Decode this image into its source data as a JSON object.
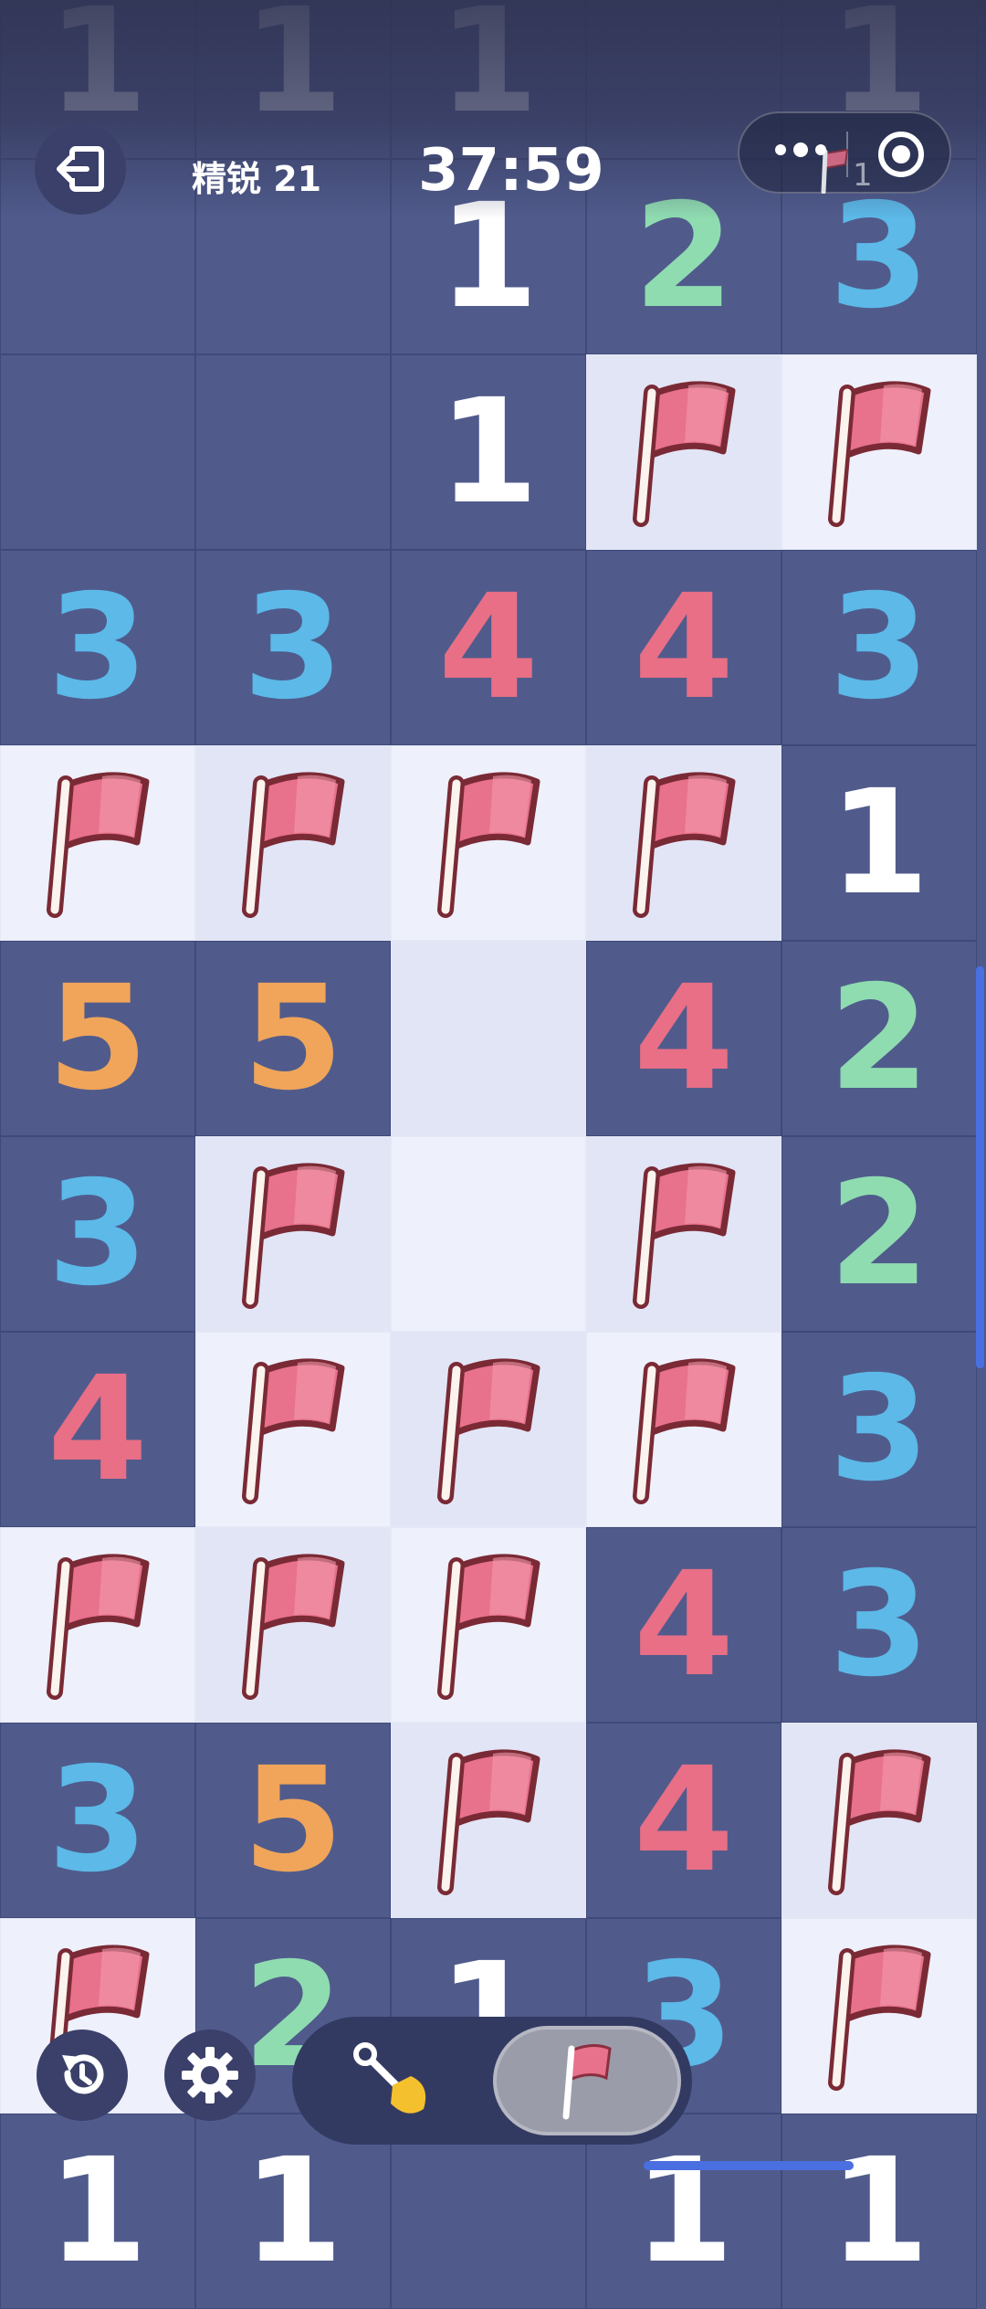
{
  "header": {
    "level_label": "精锐 21",
    "timer": "37:59",
    "flag_count": "1"
  },
  "icons": {
    "exit": "exit-icon",
    "more": "more-dots-icon",
    "target": "target-icon",
    "restart": "restart-icon",
    "settings": "gear-icon",
    "dig": "shovel-icon",
    "flag": "flag-icon"
  },
  "colors": {
    "unrevealed": "#505b8c",
    "revealed": "#eef0fb",
    "num_1": "#ffffff",
    "num_2": "#8fdcb0",
    "num_3": "#5cb9e8",
    "num_4": "#e86f86",
    "num_5": "#f0a55a",
    "flag": "#e8718c"
  },
  "board": {
    "rows": [
      [
        "1",
        "1",
        "1",
        "",
        "1"
      ],
      [
        "",
        "",
        "1",
        "2",
        "3"
      ],
      [
        "",
        "",
        "1",
        "F",
        "F"
      ],
      [
        "3",
        "3",
        "4",
        "4",
        "3"
      ],
      [
        "F",
        "F",
        "F",
        "F",
        "1"
      ],
      [
        "5",
        "5",
        "E",
        "4",
        "2"
      ],
      [
        "3",
        "F",
        "E",
        "F",
        "2"
      ],
      [
        "4",
        "F",
        "F",
        "F",
        "3"
      ],
      [
        "F",
        "F",
        "F",
        "4",
        "3"
      ],
      [
        "3",
        "5",
        "F",
        "4",
        "F"
      ],
      [
        "F",
        "2",
        "1",
        "3",
        "F"
      ],
      [
        "1",
        "1",
        "",
        "1",
        "1"
      ]
    ]
  },
  "controls": {
    "mode_selected": "flag"
  }
}
